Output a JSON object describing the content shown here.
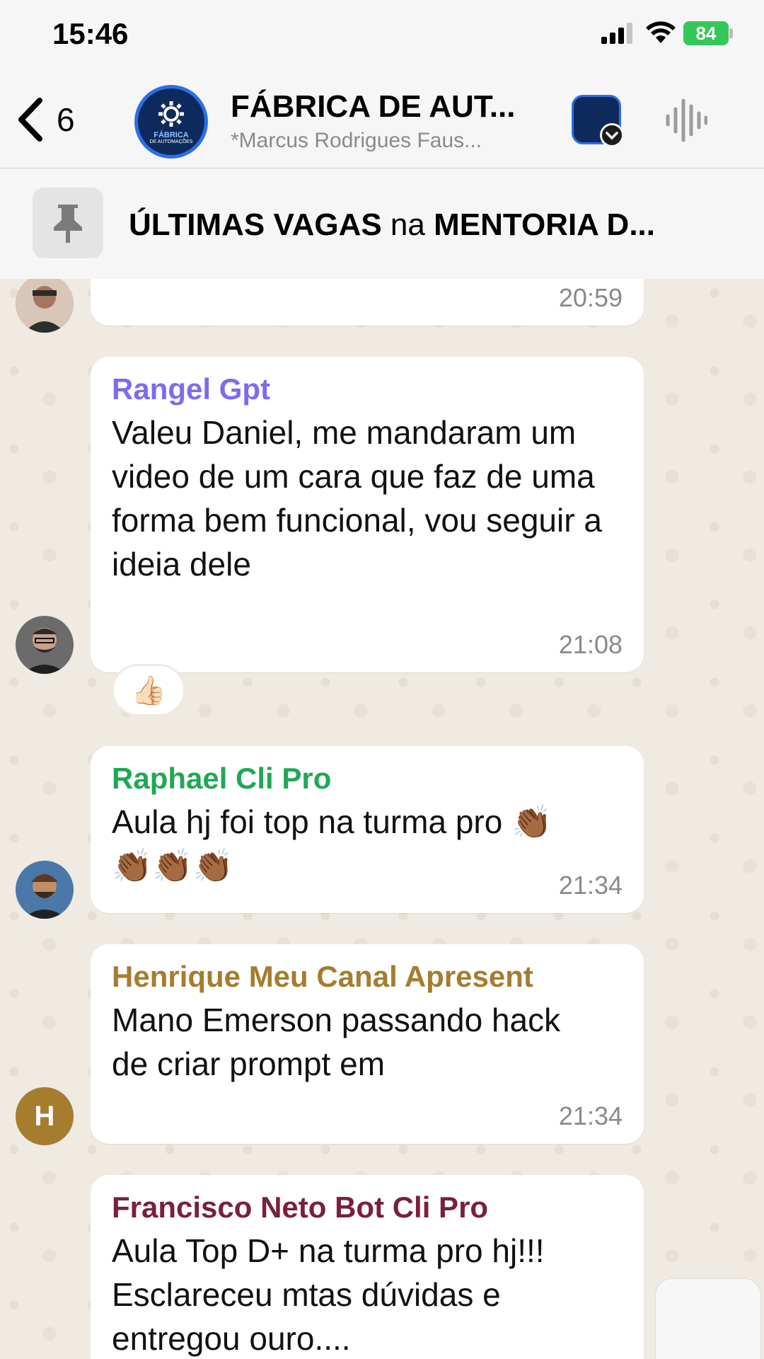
{
  "status_bar": {
    "time": "15:46",
    "battery": "84"
  },
  "header": {
    "back_count": "6",
    "avatar_text": "FÁBRICA",
    "avatar_subtext": "DE AUTOMAÇÕES",
    "title": "FÁBRICA DE AUT...",
    "subtitle": "*Marcus Rodrigues Faus..."
  },
  "pinned": {
    "bold1": "ÚLTIMAS VAGAS",
    "normal": " na ",
    "bold2": "MENTORIA D..."
  },
  "messages": [
    {
      "time": "20:59"
    },
    {
      "sender": "Rangel Gpt",
      "sender_color": "#7d6bf0",
      "text": "Valeu Daniel, me mandaram um video de um cara que faz de uma forma bem funcional, vou seguir a ideia dele",
      "time": "21:08",
      "reaction": "👍🏻"
    },
    {
      "sender": "Raphael Cli Pro",
      "sender_color": "#1fa855",
      "text": "Aula hj foi top na turma pro 👏🏾👏🏾👏🏾👏🏾",
      "time": "21:34"
    },
    {
      "sender": "Henrique Meu Canal Apresent",
      "sender_color": "#a67c2e",
      "text": "Mano Emerson passando hack de criar prompt em",
      "time": "21:34",
      "avatar_letter": "H"
    },
    {
      "sender": "Francisco Neto Bot Cli Pro",
      "sender_color": "#7a1f3d",
      "text": "Aula Top D+ na turma pro hj!!! Esclareceu mtas dúvidas e entregou ouro...."
    }
  ],
  "colors": {
    "chat_bg": "#efeae2",
    "bubble": "#ffffff",
    "timestamp": "#8a8a8a"
  }
}
